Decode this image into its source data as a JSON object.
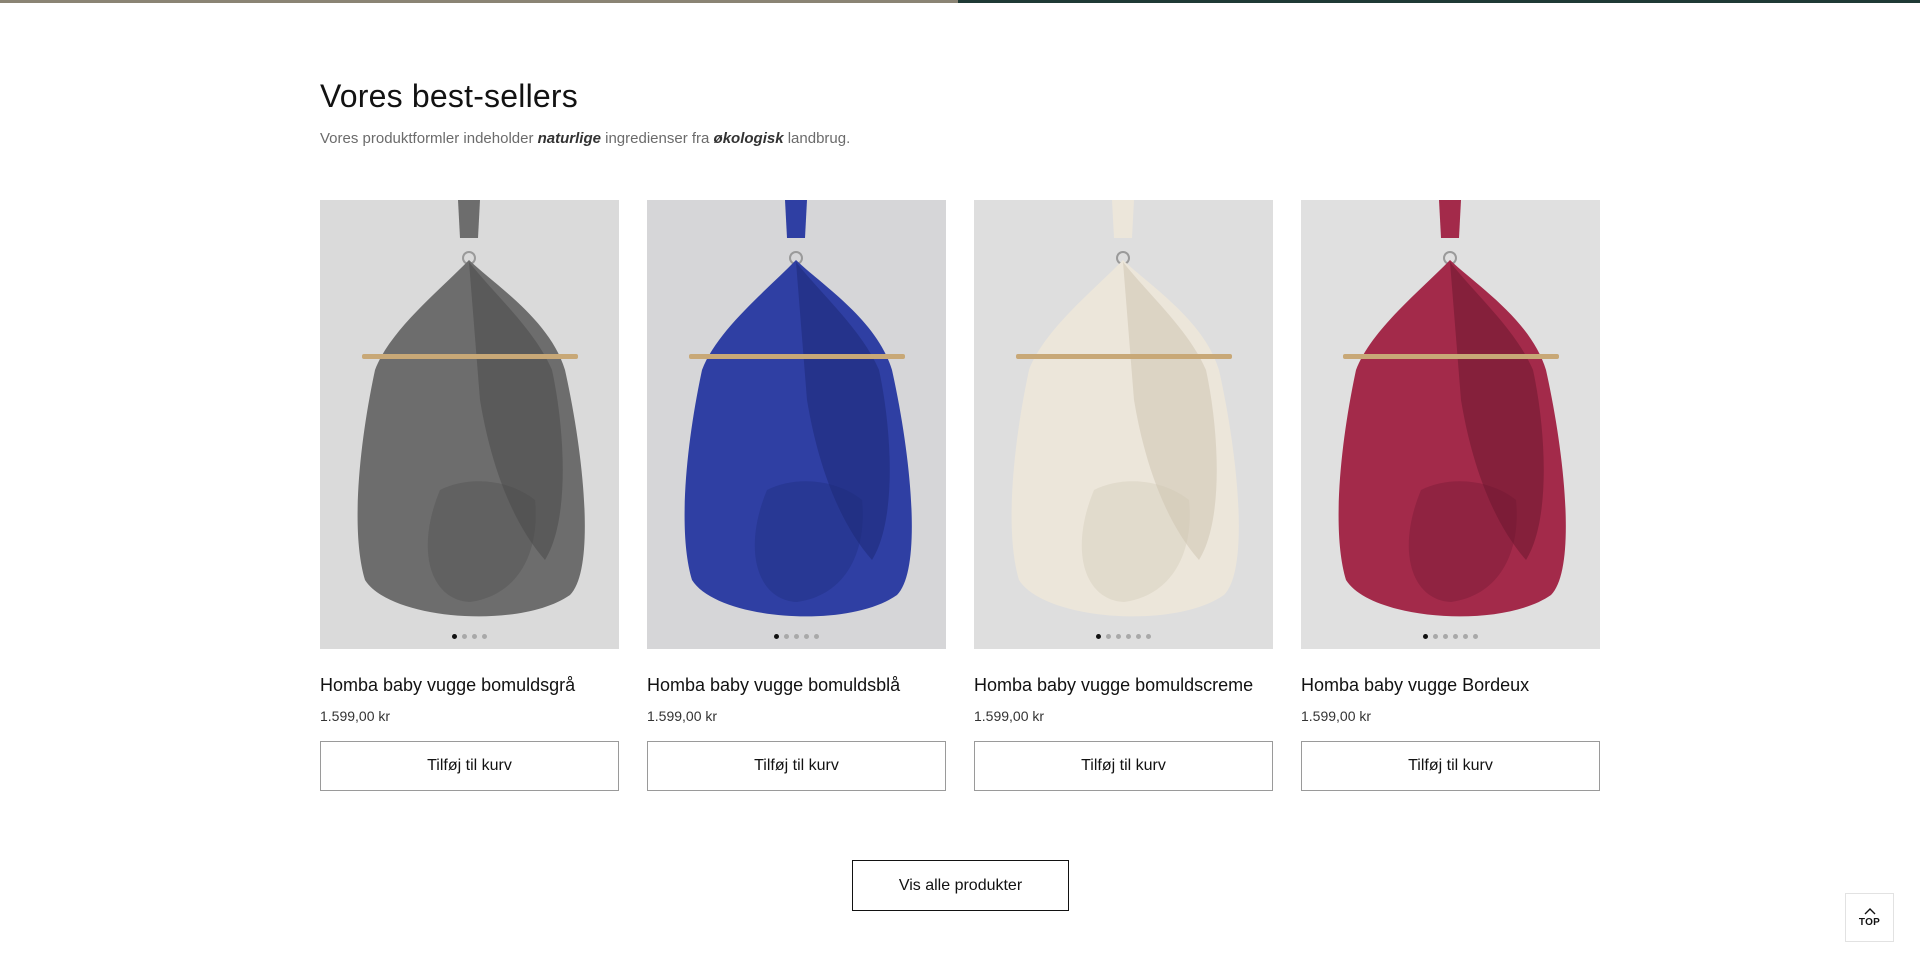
{
  "section": {
    "heading": "Vores best-sellers",
    "subtitle": {
      "part1": "Vores produktformler indeholder ",
      "em1": "naturlige",
      "part2": " ingredienser fra ",
      "em2": "økologisk",
      "part3": " landbrug."
    }
  },
  "products": [
    {
      "title": "Homba baby vugge bomuldsgrå",
      "price": "1.599,00 kr",
      "button": "Tilføj til kurv",
      "color": "#6d6d6d",
      "shade": "#4a4a4a",
      "bg": "#dadada",
      "dots": 4,
      "active_dot": 0,
      "image_icon": "hammock-cradle-grey"
    },
    {
      "title": "Homba baby vugge bomuldsblå",
      "price": "1.599,00 kr",
      "button": "Tilføj til kurv",
      "color": "#2f3fa3",
      "shade": "#1e2a78",
      "bg": "#d6d6d8",
      "dots": 5,
      "active_dot": 0,
      "image_icon": "hammock-cradle-blue"
    },
    {
      "title": "Homba baby vugge bomuldscreme",
      "price": "1.599,00 kr",
      "button": "Tilføj til kurv",
      "color": "#ece6da",
      "shade": "#cfc5b3",
      "bg": "#dedede",
      "dots": 6,
      "active_dot": 0,
      "image_icon": "hammock-cradle-cream"
    },
    {
      "title": "Homba baby vugge Bordeux",
      "price": "1.599,00 kr",
      "button": "Tilføj til kurv",
      "color": "#a32a4a",
      "shade": "#6e1730",
      "bg": "#e0e0e0",
      "dots": 6,
      "active_dot": 0,
      "image_icon": "hammock-cradle-bordeaux"
    }
  ],
  "view_all": "Vis alle produkter",
  "back_to_top": {
    "label": "TOP",
    "icon": "chevron-up-icon"
  },
  "colors": {
    "progress_left": "#8a8474",
    "progress_right": "#1f3a35",
    "text": "#121212"
  }
}
